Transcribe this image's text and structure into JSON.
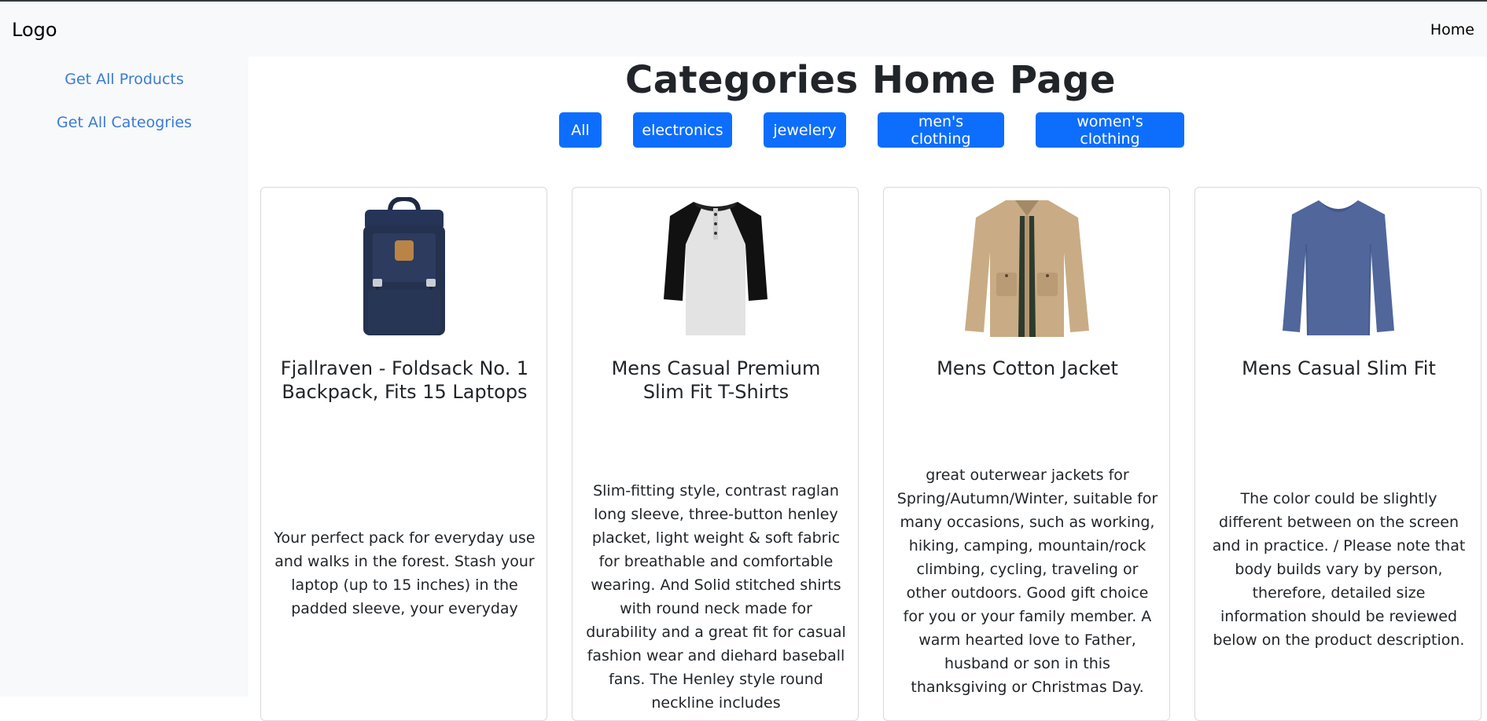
{
  "navbar": {
    "logo": "Logo",
    "home": "Home"
  },
  "sidebar": {
    "items": [
      {
        "label": "Get All Products"
      },
      {
        "label": "Get All Cateogries"
      }
    ]
  },
  "main": {
    "title": "Categories Home Page",
    "filters": [
      {
        "label": "All"
      },
      {
        "label": "electronics"
      },
      {
        "label": "jewelery"
      },
      {
        "label": "men's clothing"
      },
      {
        "label": "women's clothing"
      }
    ],
    "products": [
      {
        "title": "Fjallraven - Foldsack No. 1 Backpack, Fits 15 Laptops",
        "description": "Your perfect pack for everyday use and walks in the forest. Stash your laptop (up to 15 inches) in the padded sleeve, your everyday",
        "image": "backpack"
      },
      {
        "title": "Mens Casual Premium Slim Fit T-Shirts",
        "description": "Slim-fitting style, contrast raglan long sleeve, three-button henley placket, light weight & soft fabric for breathable and comfortable wearing. And Solid stitched shirts with round neck made for durability and a great fit for casual fashion wear and diehard baseball fans. The Henley style round neckline includes",
        "image": "raglan-shirt"
      },
      {
        "title": "Mens Cotton Jacket",
        "description": "great outerwear jackets for Spring/Autumn/Winter, suitable for many occasions, such as working, hiking, camping, mountain/rock climbing, cycling, traveling or other outdoors. Good gift choice for you or your family member. A warm hearted love to Father, husband or son in this thanksgiving or Christmas Day.",
        "image": "jacket"
      },
      {
        "title": "Mens Casual Slim Fit",
        "description": "The color could be slightly different between on the screen and in practice. / Please note that body builds vary by person, therefore, detailed size information should be reviewed below on the product description.",
        "image": "long-sleeve-shirt"
      }
    ]
  }
}
